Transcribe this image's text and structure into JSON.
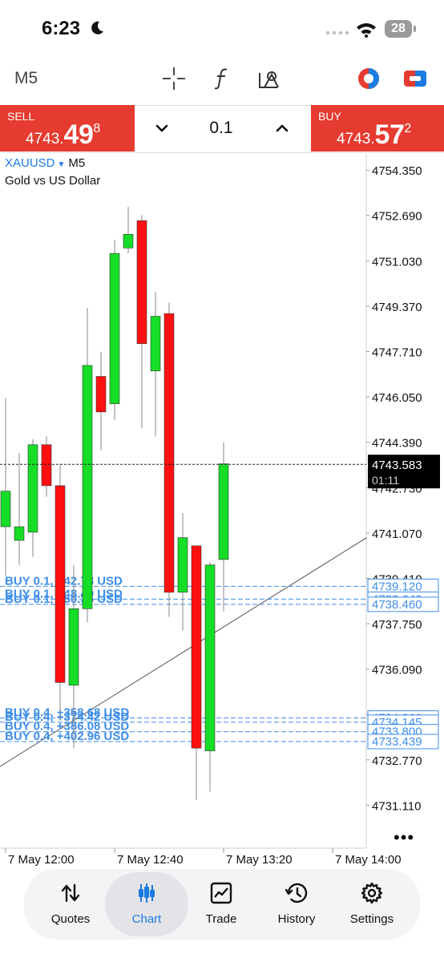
{
  "status_bar": {
    "time": "6:23",
    "battery": "28"
  },
  "toolbar": {
    "timeframe": "M5",
    "icons": [
      "crosshair-icon",
      "indicator-f-icon",
      "objects-icon",
      "color-scheme-icon",
      "one-click-trade-icon"
    ]
  },
  "trade_panel": {
    "sell": {
      "label": "SELL",
      "price_small": "4743.",
      "price_big": "49",
      "price_sup": "8"
    },
    "buy": {
      "label": "BUY",
      "price_small": "4743.",
      "price_big": "57",
      "price_sup": "2"
    },
    "volume": "0.1"
  },
  "chart": {
    "symbol": "XAUUSD",
    "timeframe": "M5",
    "description": "Gold vs US Dollar"
  },
  "chart_data": {
    "type": "candlestick",
    "y_ticks": [
      "4754.350",
      "4752.690",
      "4751.030",
      "4749.370",
      "4747.710",
      "4746.050",
      "4744.390",
      "4742.730",
      "4741.070",
      "4739.410",
      "4737.750",
      "4736.090",
      "4734.430",
      "4732.770",
      "4731.110"
    ],
    "ylim": [
      4730.3,
      4755.0
    ],
    "x_labels": [
      {
        "label": "7 May 12:00",
        "index": 0
      },
      {
        "label": "7 May 12:40",
        "index": 8
      },
      {
        "label": "7 May 13:20",
        "index": 16
      },
      {
        "label": "7 May 14:00",
        "index": 24
      }
    ],
    "candles": [
      {
        "o": 4741.3,
        "h": 4746.0,
        "l": 4739.5,
        "c": 4742.6
      },
      {
        "o": 4740.8,
        "h": 4744.0,
        "l": 4739.9,
        "c": 4741.3
      },
      {
        "o": 4741.1,
        "h": 4744.5,
        "l": 4740.2,
        "c": 4744.3
      },
      {
        "o": 4744.3,
        "h": 4744.6,
        "l": 4742.4,
        "c": 4742.8
      },
      {
        "o": 4742.8,
        "h": 4743.6,
        "l": 4734.2,
        "c": 4735.6
      },
      {
        "o": 4735.5,
        "h": 4739.9,
        "l": 4733.2,
        "c": 4738.3
      },
      {
        "o": 4738.3,
        "h": 4749.3,
        "l": 4737.8,
        "c": 4747.2
      },
      {
        "o": 4746.8,
        "h": 4747.7,
        "l": 4744.1,
        "c": 4745.5
      },
      {
        "o": 4745.8,
        "h": 4751.8,
        "l": 4745.2,
        "c": 4751.3
      },
      {
        "o": 4751.5,
        "h": 4753.0,
        "l": 4751.3,
        "c": 4752.0
      },
      {
        "o": 4752.5,
        "h": 4752.7,
        "l": 4744.9,
        "c": 4748.0
      },
      {
        "o": 4747.0,
        "h": 4749.9,
        "l": 4744.6,
        "c": 4749.0
      },
      {
        "o": 4749.1,
        "h": 4749.5,
        "l": 4738.0,
        "c": 4738.9
      },
      {
        "o": 4738.9,
        "h": 4741.8,
        "l": 4737.5,
        "c": 4740.9
      },
      {
        "o": 4740.6,
        "h": 4740.6,
        "l": 4731.3,
        "c": 4733.2
      },
      {
        "o": 4733.1,
        "h": 4740.0,
        "l": 4731.6,
        "c": 4739.9
      },
      {
        "o": 4740.1,
        "h": 4744.4,
        "l": 4738.2,
        "c": 4743.6
      }
    ],
    "current_price": {
      "value": 4743.583,
      "label": "4743.583",
      "timer": "01:11"
    },
    "trend_line": {
      "from": {
        "index": -0.5,
        "price": 4732.5
      },
      "to": {
        "index": 26.5,
        "price": 4740.9
      }
    },
    "order_lines": [
      {
        "label": "BUY 0.1, +42.78 USD",
        "price": 4739.12,
        "price_label": "4739.120"
      },
      {
        "label": "BUY 0.1, +48.49 USD",
        "price": 4738.649,
        "price_label": "4738.649"
      },
      {
        "label": "BUY 0.1, +50.35 USD",
        "price": 4738.46,
        "price_label": "4738.460"
      },
      {
        "label": "BUY 0.4, +358.68 USD",
        "price": 4734.3,
        "price_label": "4734.300"
      },
      {
        "label": "BUY 0.4, +374.42 USD",
        "price": 4734.145,
        "price_label": "4734.145"
      },
      {
        "label": "BUY 0.4, +386.08 USD",
        "price": 4733.8,
        "price_label": "4733.800"
      },
      {
        "label": "BUY 0.4, +402.96 USD",
        "price": 4733.439,
        "price_label": "4733.439"
      }
    ],
    "colors": {
      "bull": "#16dd26",
      "bear": "#ff1010",
      "order": "#3d8ee8",
      "price_bg": "#000000"
    }
  },
  "bottom_nav": [
    {
      "label": "Quotes",
      "icon": "quotes-arrows-icon",
      "active": false
    },
    {
      "label": "Chart",
      "icon": "chart-candles-icon",
      "active": true
    },
    {
      "label": "Trade",
      "icon": "trade-chart-icon",
      "active": false
    },
    {
      "label": "History",
      "icon": "history-clock-icon",
      "active": false
    },
    {
      "label": "Settings",
      "icon": "settings-gear-icon",
      "active": false
    }
  ]
}
